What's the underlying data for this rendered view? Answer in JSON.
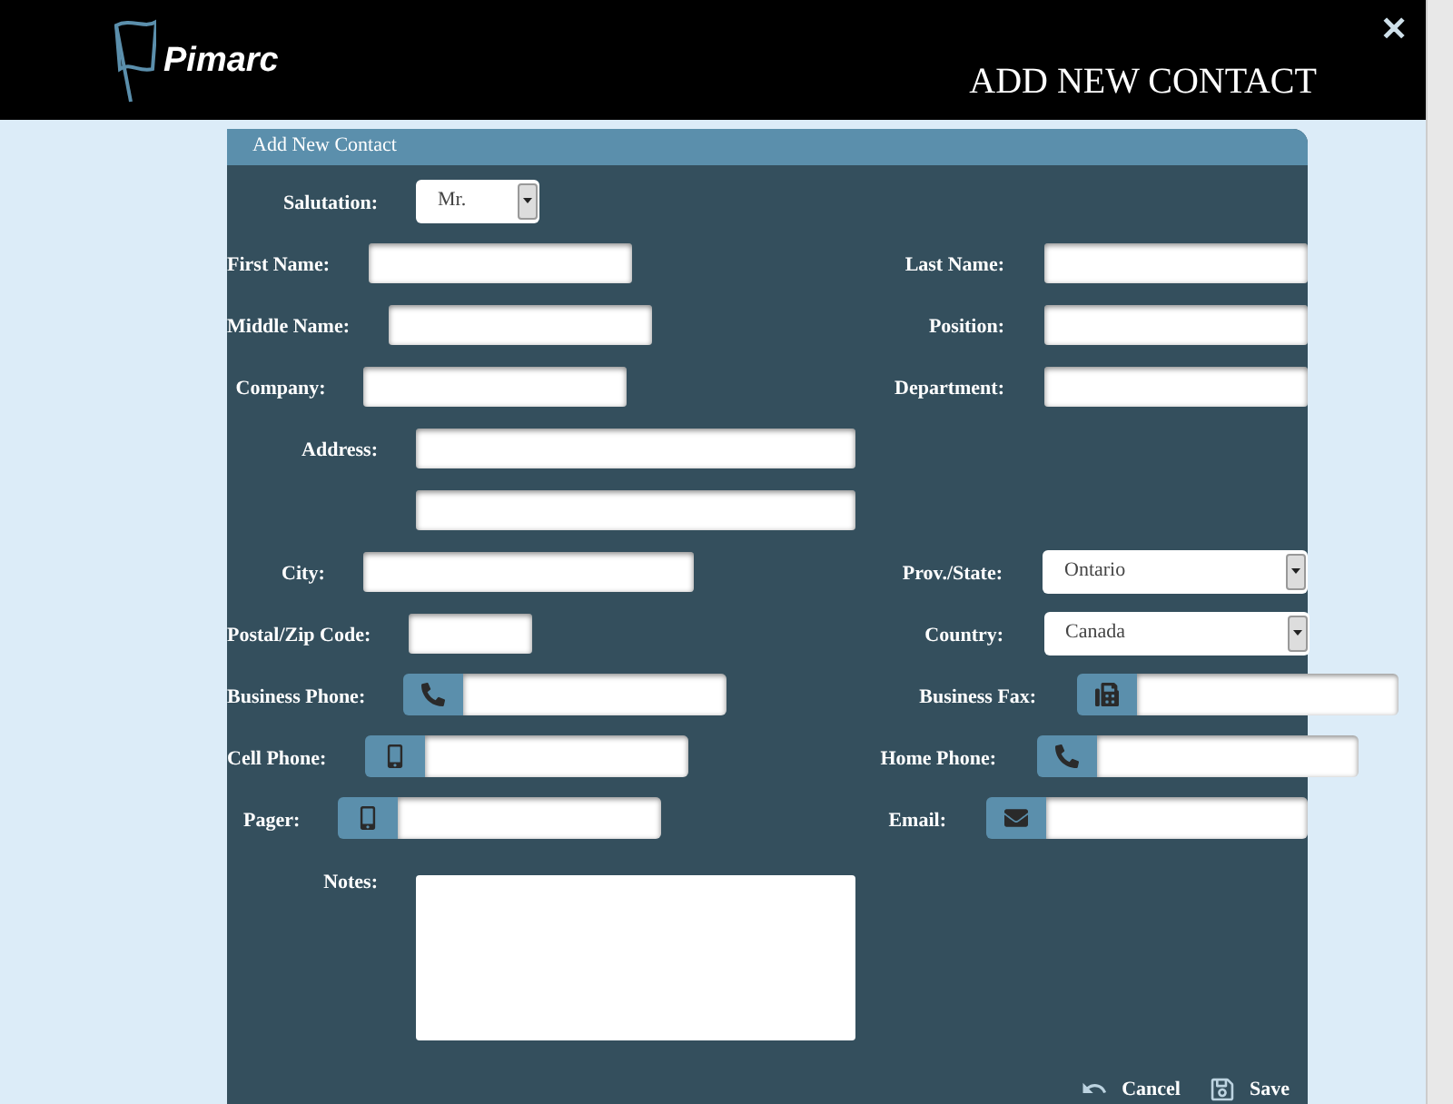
{
  "header": {
    "logo": "Pimarc",
    "title": "ADD NEW CONTACT",
    "close": "✕"
  },
  "panel": {
    "title": "Add New Contact",
    "rows": [
      {
        "left": {
          "label": "Salutation:",
          "kind": "select",
          "value": "Mr."
        }
      },
      {
        "left": {
          "label": "First Name:",
          "kind": "text"
        },
        "right": {
          "label": "Last Name:",
          "kind": "text"
        }
      },
      {
        "left": {
          "label": "Middle Name:",
          "kind": "text"
        },
        "right": {
          "label": "Position:",
          "kind": "text"
        }
      },
      {
        "left": {
          "label": "Company:",
          "kind": "text"
        },
        "right": {
          "label": "Department:",
          "kind": "text"
        }
      },
      {
        "left": {
          "label": "Address:",
          "kind": "text"
        }
      },
      {
        "left": {
          "kind": "text"
        }
      },
      {
        "left": {
          "label": "City:",
          "kind": "text"
        },
        "right": {
          "label": "Prov./State:",
          "kind": "select",
          "value": "Ontario"
        }
      },
      {
        "left": {
          "label": "Postal/Zip Code:",
          "kind": "text"
        },
        "right": {
          "label": "Country:",
          "kind": "select",
          "value": "Canada"
        }
      },
      {
        "left": {
          "label": "Business Phone:",
          "kind": "phone"
        },
        "right": {
          "label": "Business Fax:",
          "kind": "fax"
        }
      },
      {
        "left": {
          "label": "Cell Phone:",
          "kind": "mobile"
        },
        "right": {
          "label": "Home Phone:",
          "kind": "phone"
        }
      },
      {
        "left": {
          "label": "Pager:",
          "kind": "mobile"
        },
        "right": {
          "label": "Email:",
          "kind": "email"
        }
      },
      {
        "left": {
          "label": "Notes:",
          "kind": "notes"
        }
      }
    ],
    "buttons": [
      {
        "label": "Cancel",
        "kind": "cancel"
      },
      {
        "label": "Save",
        "kind": "save"
      }
    ]
  }
}
